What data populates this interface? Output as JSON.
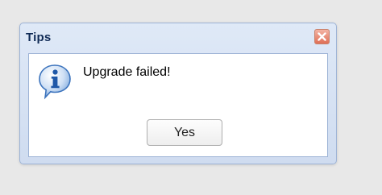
{
  "dialog": {
    "title": "Tips",
    "message": "Upgrade failed!",
    "icon": "info-icon",
    "close_icon": "close-icon",
    "buttons": {
      "yes_label": "Yes"
    }
  },
  "colors": {
    "title_text": "#0f2a55",
    "dialog_frame": "#dfe9f7",
    "close_button": "#df6f56",
    "info_icon": "#2c6fc1"
  }
}
